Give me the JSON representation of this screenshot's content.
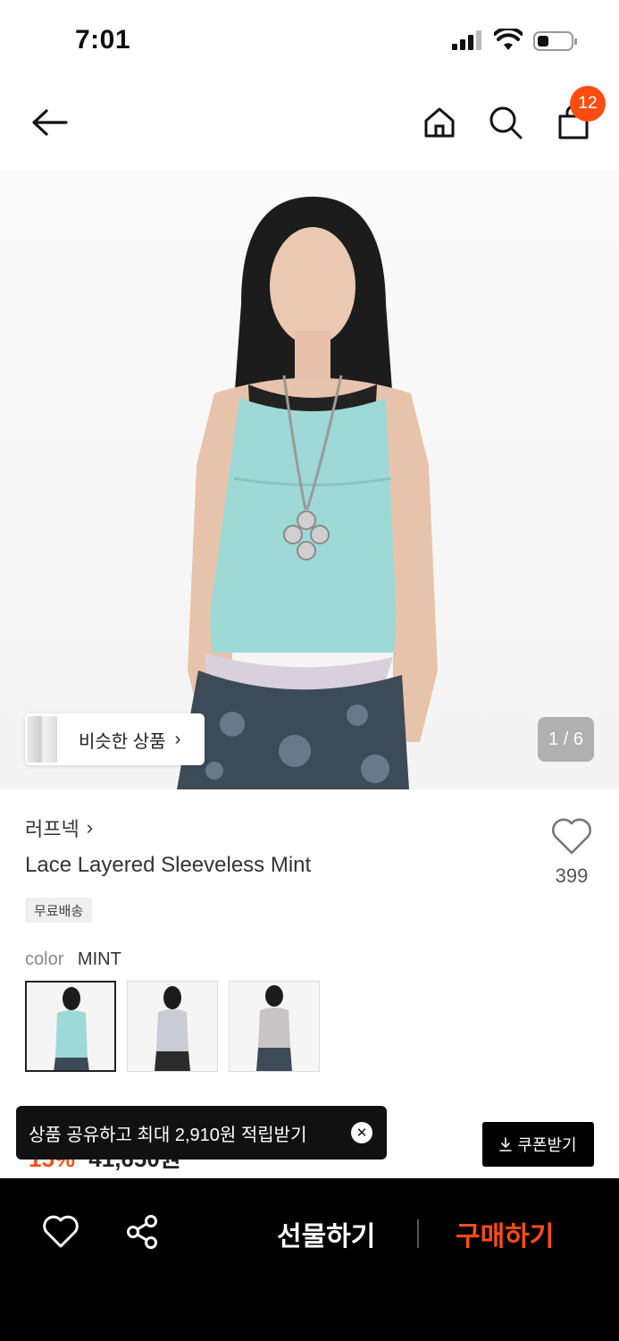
{
  "status": {
    "time": "7:01"
  },
  "header": {
    "cart_count": "12"
  },
  "gallery": {
    "counter": "1 / 6",
    "similar_label": "비슷한 상품",
    "similar_chevron": "›"
  },
  "product": {
    "brand": "러프넥",
    "brand_chevron": "›",
    "title": "Lace Layered Sleeveless Mint",
    "free_shipping": "무료배송",
    "like_count": "399",
    "color_label": "color",
    "color_value": "MINT",
    "price_discount": "15%",
    "price": "41,650원"
  },
  "toast": {
    "text": "상품 공유하고 최대 2,910원 적립받기",
    "close": "✕"
  },
  "coupon": {
    "label": "쿠폰받기",
    "icon": "download-icon"
  },
  "bottom_bar": {
    "gift_label": "선물하기",
    "buy_label": "구매하기"
  },
  "colors": {
    "accent": "#ff4d12",
    "dark": "#000000"
  }
}
